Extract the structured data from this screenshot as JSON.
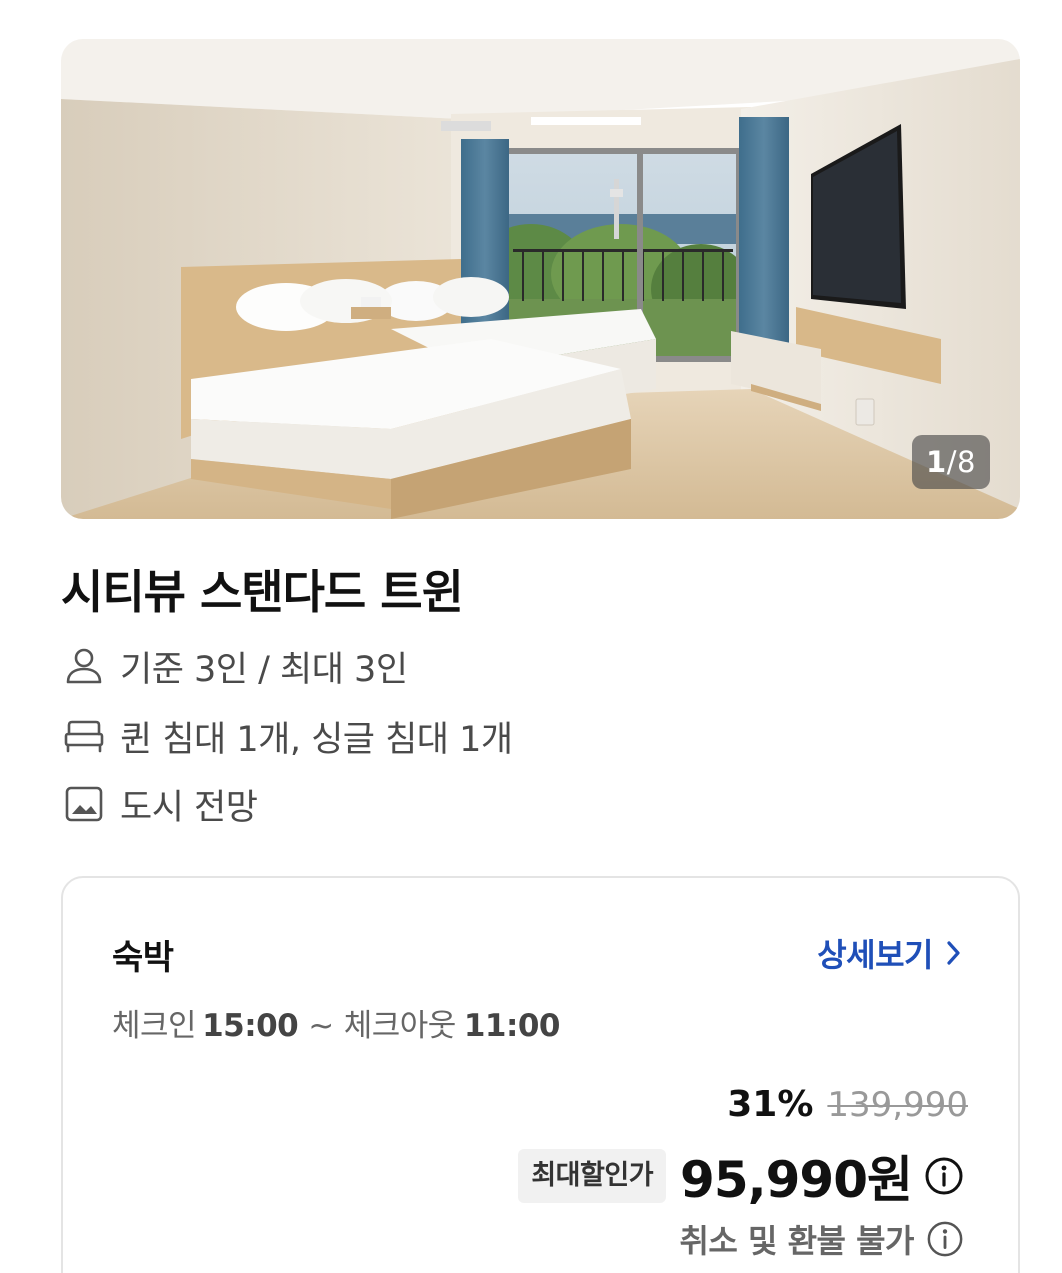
{
  "gallery": {
    "current": "1",
    "separator": "/",
    "total": "8"
  },
  "room": {
    "title": "시티뷰 스탠다드 트윈",
    "guests": "기준 3인 / 최대 3인",
    "beds": "퀸 침대 1개, 싱글 침대 1개",
    "view": "도시 전망",
    "icons": [
      "person-icon",
      "bed-icon",
      "image-icon"
    ]
  },
  "stay": {
    "label": "숙박",
    "detail_link": "상세보기",
    "checkin_label": "체크인",
    "checkin_time": "15:00",
    "tilde": "~",
    "checkout_label": "체크아웃",
    "checkout_time": "11:00",
    "discount_percent": "31%",
    "original_price": "139,990",
    "max_discount_label": "최대할인가",
    "final_price": "95,990원",
    "refund_note": "취소 및 환불 불가"
  },
  "colors": {
    "link": "#1f4fb8",
    "text_primary": "#111111",
    "text_secondary": "#4a4a4a",
    "badge_bg": "#f1f1f1",
    "card_border": "#e4e4e4"
  }
}
